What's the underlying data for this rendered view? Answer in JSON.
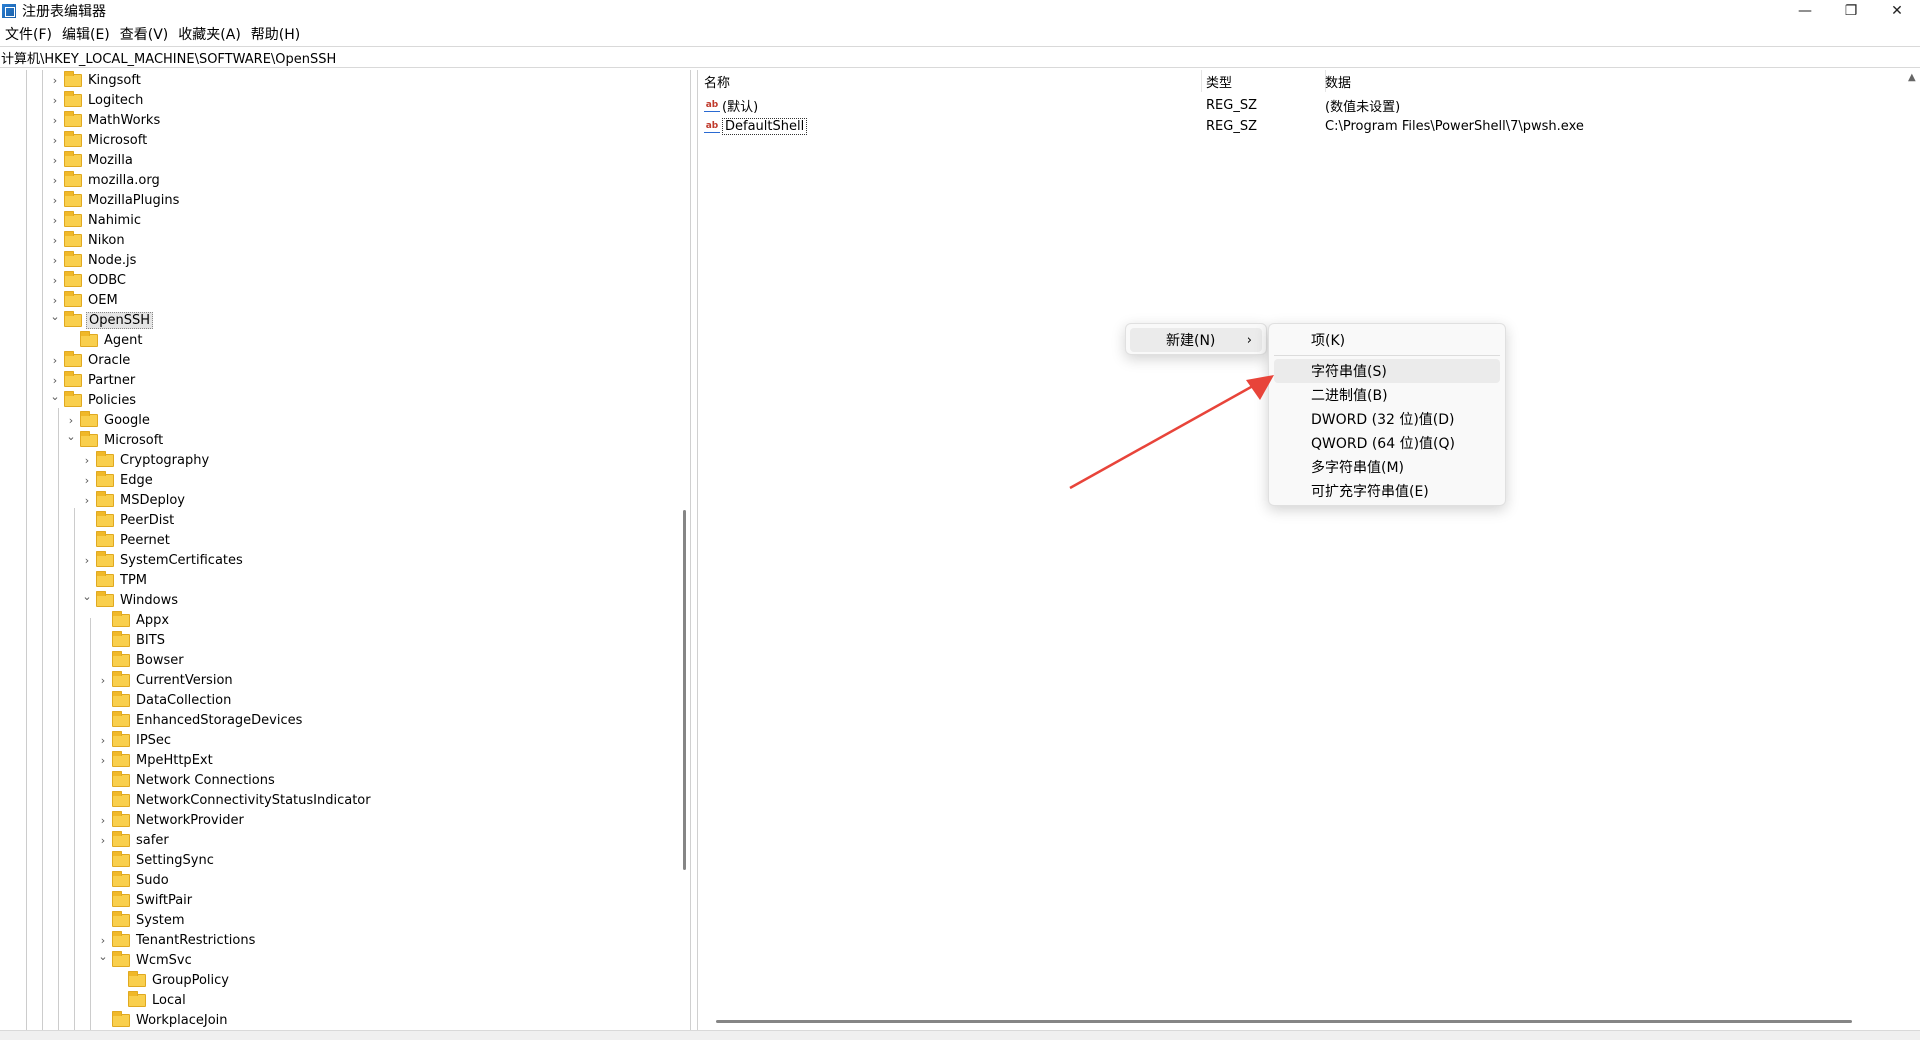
{
  "window": {
    "title": "注册表编辑器",
    "minimize": "—",
    "maximize": "❐",
    "close": "✕"
  },
  "menubar": [
    "文件(F)",
    "编辑(E)",
    "查看(V)",
    "收藏夹(A)",
    "帮助(H)"
  ],
  "address": "计算机\\HKEY_LOCAL_MACHINE\\SOFTWARE\\OpenSSH",
  "tree": [
    {
      "label": "Kingsoft",
      "level": 0,
      "expander": "collapsed"
    },
    {
      "label": "Logitech",
      "level": 0,
      "expander": "collapsed"
    },
    {
      "label": "MathWorks",
      "level": 0,
      "expander": "collapsed"
    },
    {
      "label": "Microsoft",
      "level": 0,
      "expander": "collapsed"
    },
    {
      "label": "Mozilla",
      "level": 0,
      "expander": "collapsed"
    },
    {
      "label": "mozilla.org",
      "level": 0,
      "expander": "collapsed"
    },
    {
      "label": "MozillaPlugins",
      "level": 0,
      "expander": "collapsed"
    },
    {
      "label": "Nahimic",
      "level": 0,
      "expander": "collapsed"
    },
    {
      "label": "Nikon",
      "level": 0,
      "expander": "collapsed"
    },
    {
      "label": "Node.js",
      "level": 0,
      "expander": "collapsed"
    },
    {
      "label": "ODBC",
      "level": 0,
      "expander": "collapsed"
    },
    {
      "label": "OEM",
      "level": 0,
      "expander": "collapsed"
    },
    {
      "label": "OpenSSH",
      "level": 0,
      "expander": "expanded",
      "selected": true
    },
    {
      "label": "Agent",
      "level": 1,
      "expander": "none"
    },
    {
      "label": "Oracle",
      "level": 0,
      "expander": "collapsed"
    },
    {
      "label": "Partner",
      "level": 0,
      "expander": "collapsed"
    },
    {
      "label": "Policies",
      "level": 0,
      "expander": "expanded"
    },
    {
      "label": "Google",
      "level": 1,
      "expander": "collapsed"
    },
    {
      "label": "Microsoft",
      "level": 1,
      "expander": "expanded"
    },
    {
      "label": "Cryptography",
      "level": 2,
      "expander": "collapsed"
    },
    {
      "label": "Edge",
      "level": 2,
      "expander": "collapsed"
    },
    {
      "label": "MSDeploy",
      "level": 2,
      "expander": "collapsed"
    },
    {
      "label": "PeerDist",
      "level": 2,
      "expander": "none"
    },
    {
      "label": "Peernet",
      "level": 2,
      "expander": "none"
    },
    {
      "label": "SystemCertificates",
      "level": 2,
      "expander": "collapsed"
    },
    {
      "label": "TPM",
      "level": 2,
      "expander": "none"
    },
    {
      "label": "Windows",
      "level": 2,
      "expander": "expanded"
    },
    {
      "label": "Appx",
      "level": 3,
      "expander": "none"
    },
    {
      "label": "BITS",
      "level": 3,
      "expander": "none"
    },
    {
      "label": "Bowser",
      "level": 3,
      "expander": "none"
    },
    {
      "label": "CurrentVersion",
      "level": 3,
      "expander": "collapsed"
    },
    {
      "label": "DataCollection",
      "level": 3,
      "expander": "none"
    },
    {
      "label": "EnhancedStorageDevices",
      "level": 3,
      "expander": "none"
    },
    {
      "label": "IPSec",
      "level": 3,
      "expander": "collapsed"
    },
    {
      "label": "MpeHttpExt",
      "level": 3,
      "expander": "collapsed"
    },
    {
      "label": "Network Connections",
      "level": 3,
      "expander": "none"
    },
    {
      "label": "NetworkConnectivityStatusIndicator",
      "level": 3,
      "expander": "none"
    },
    {
      "label": "NetworkProvider",
      "level": 3,
      "expander": "collapsed"
    },
    {
      "label": "safer",
      "level": 3,
      "expander": "collapsed"
    },
    {
      "label": "SettingSync",
      "level": 3,
      "expander": "none"
    },
    {
      "label": "Sudo",
      "level": 3,
      "expander": "none"
    },
    {
      "label": "SwiftPair",
      "level": 3,
      "expander": "none"
    },
    {
      "label": "System",
      "level": 3,
      "expander": "none"
    },
    {
      "label": "TenantRestrictions",
      "level": 3,
      "expander": "collapsed"
    },
    {
      "label": "WcmSvc",
      "level": 3,
      "expander": "expanded"
    },
    {
      "label": "GroupPolicy",
      "level": 4,
      "expander": "none"
    },
    {
      "label": "Local",
      "level": 4,
      "expander": "none"
    },
    {
      "label": "WorkplaceJoin",
      "level": 3,
      "expander": "none"
    }
  ],
  "list": {
    "columns": [
      "名称",
      "类型",
      "数据"
    ],
    "rows": [
      {
        "name": "(默认)",
        "type": "REG_SZ",
        "data": "(数值未设置)"
      },
      {
        "name": "DefaultShell",
        "type": "REG_SZ",
        "data": "C:\\Program Files\\PowerShell\\7\\pwsh.exe"
      }
    ]
  },
  "context_menu": {
    "new_label": "新建(N)",
    "arrow": "›",
    "submenu": {
      "key": "项(K)",
      "items": [
        "字符串值(S)",
        "二进制值(B)",
        "DWORD (32 位)值(D)",
        "QWORD (64 位)值(Q)",
        "多字符串值(M)",
        "可扩充字符串值(E)"
      ]
    }
  },
  "colors": {
    "annotation_arrow": "#e8443a",
    "folder": "#f9cf4d"
  }
}
